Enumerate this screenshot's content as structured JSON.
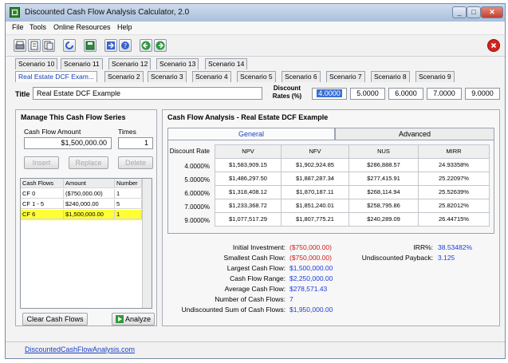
{
  "window": {
    "title": "Discounted Cash Flow Analysis Calculator, 2.0",
    "min_glyph": "_",
    "max_glyph": "□",
    "close_glyph": "✕"
  },
  "menu": [
    "File",
    "Tools",
    "Online Resources",
    "Help"
  ],
  "toolbar_icons": [
    "printer-icon",
    "document-icon",
    "documents-icon",
    "refresh-icon",
    "save-icon",
    "arrow-icon",
    "help-icon",
    "back-icon",
    "forward-icon",
    "exit-icon"
  ],
  "tabs_row1": [
    "Scenario 10",
    "Scenario 11",
    "Scenario 12",
    "Scenario 13",
    "Scenario 14"
  ],
  "tabs_row2": [
    "Real Estate DCF Exam...",
    "Scenario 2",
    "Scenario 3",
    "Scenario 4",
    "Scenario 5",
    "Scenario 6",
    "Scenario 7",
    "Scenario 8",
    "Scenario 9"
  ],
  "title_label": "Title",
  "title_value": "Real Estate DCF Example",
  "discount": {
    "label_line1": "Discount",
    "label_line2": "Rates (%)",
    "rates": [
      "4.0000",
      "5.0000",
      "6.0000",
      "7.0000",
      "9.0000"
    ]
  },
  "manage": {
    "title": "Manage This Cash Flow Series",
    "amount_label": "Cash Flow Amount",
    "times_label": "Times",
    "amount_value": "$1,500,000.00",
    "times_value": "1",
    "insert": "Insert",
    "replace": "Replace",
    "delete": "Delete",
    "headers": [
      "Cash Flows",
      "Amount",
      "Number"
    ],
    "rows": [
      [
        "CF 0",
        "($750,000.00)",
        "1"
      ],
      [
        "CF 1 - 5",
        "$240,000.00",
        "5"
      ],
      [
        "CF 6",
        "$1,500,000.00",
        "1"
      ]
    ],
    "clear": "Clear Cash Flows",
    "analyze": "Analyze"
  },
  "analysis": {
    "title": "Cash Flow Analysis - Real Estate DCF Example",
    "tab_general": "General",
    "tab_advanced": "Advanced",
    "row_header": "Discount Rate",
    "col_headers": [
      "NPV",
      "NFV",
      "NUS",
      "MIRR"
    ],
    "rows": [
      {
        "rate": "4.0000%",
        "cells": [
          "$1,583,909.15",
          "$1,902,924.85",
          "$286,888.57",
          "24.93358%"
        ]
      },
      {
        "rate": "5.0000%",
        "cells": [
          "$1,486,297.50",
          "$1,887,287.34",
          "$277,415.91",
          "25.22097%"
        ]
      },
      {
        "rate": "6.0000%",
        "cells": [
          "$1,318,408.12",
          "$1,870,187.11",
          "$268,114.94",
          "25.52639%"
        ]
      },
      {
        "rate": "7.0000%",
        "cells": [
          "$1,233,368.72",
          "$1,851,240.01",
          "$258,795.86",
          "25.82012%"
        ]
      },
      {
        "rate": "9.0000%",
        "cells": [
          "$1,077,517.29",
          "$1,807,775.21",
          "$240,289.09",
          "26.44715%"
        ]
      }
    ]
  },
  "summary": {
    "left": [
      {
        "label": "Initial Investment:",
        "value": "($750,000.00)",
        "red": true
      },
      {
        "label": "Smallest Cash Flow:",
        "value": "($750,000.00)",
        "red": true
      },
      {
        "label": "Largest Cash Flow:",
        "value": "$1,500,000.00",
        "red": false
      },
      {
        "label": "Cash Flow Range:",
        "value": "$2,250,000.00",
        "red": false
      },
      {
        "label": "Average Cash Flow:",
        "value": "$278,571.43",
        "red": false
      },
      {
        "label": "Number of Cash Flows:",
        "value": "7",
        "red": false
      },
      {
        "label": "Undiscounted Sum of Cash Flows:",
        "value": "$1,950,000.00",
        "red": false
      }
    ],
    "right": [
      {
        "label": "IRR%:",
        "value": "38.53482%"
      },
      {
        "label": "Undiscounted Payback:",
        "value": "3.125"
      }
    ]
  },
  "status_link": "DiscountedCashFlowAnalysis.com",
  "colors": {
    "selected_row": "#ffff33",
    "link": "#1a3fc8",
    "negative": "#d21c1c"
  }
}
